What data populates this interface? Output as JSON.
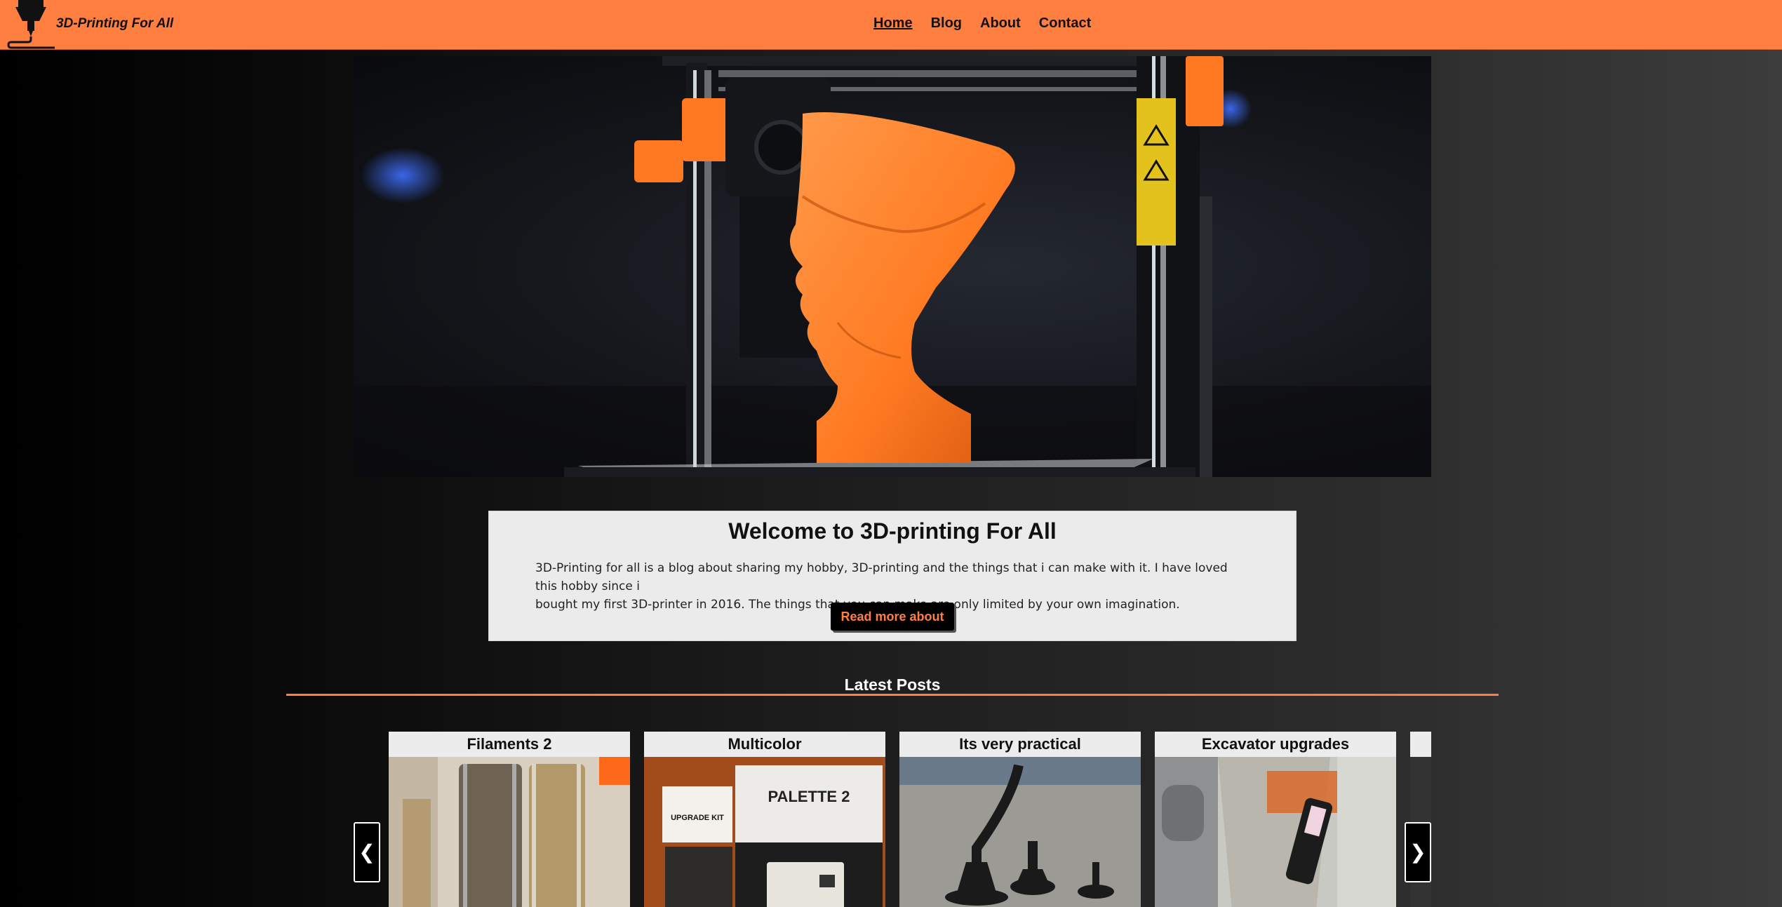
{
  "header": {
    "logo_text": "3D-Printing For All",
    "nav": [
      {
        "label": "Home",
        "active": true
      },
      {
        "label": "Blog",
        "active": false
      },
      {
        "label": "About",
        "active": false
      },
      {
        "label": "Contact",
        "active": false
      }
    ],
    "accent_color": "#ff7f40"
  },
  "hero": {
    "image_icon": "3d-printer-bust-photo"
  },
  "welcome": {
    "title": "Welcome to 3D-printing For All",
    "line1": "3D-Printing for all is a blog about sharing my hobby, 3D-printing and the things that i can make with it. I have loved this hobby since i",
    "line2": "bought my first 3D-printer in 2016. The things that you can make are only limited by your own imagination.",
    "button_label": "Read more about"
  },
  "latest": {
    "title": "Latest Posts",
    "prev_label": "❮",
    "next_label": "❯",
    "posts": [
      {
        "title": "Filaments 2"
      },
      {
        "title": "Multicolor",
        "image_labels": [
          "UPGRADE KIT",
          "PALETTE 2"
        ]
      },
      {
        "title": "Its very practical"
      },
      {
        "title": "Excavator upgrades"
      }
    ]
  }
}
